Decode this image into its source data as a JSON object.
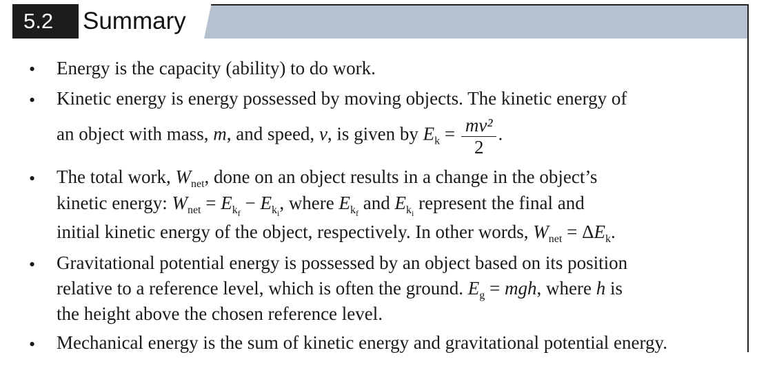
{
  "section": {
    "number": "5.2",
    "title": "Summary"
  },
  "colors": {
    "header_dark": "#1c1c1c",
    "header_bar": "#b6c1cf"
  },
  "bullets": {
    "b1": {
      "line1": "Energy is the capacity (ability) to do work."
    },
    "b2": {
      "line1": "Kinetic energy is energy possessed by moving objects. The kinetic energy of",
      "line2_pre": "an object with mass, ",
      "m": "m",
      "line2_mid": ", and speed, ",
      "v": "v",
      "line2_post": ", is given by ",
      "Ek": "E",
      "k_sub": "k",
      "eq": " = ",
      "frac_num": "mv²",
      "frac_den": "2",
      "end": "."
    },
    "b3": {
      "line1_pre": "The total work, ",
      "W": "W",
      "net": "net",
      "line1_post": ", done on an object results in a change in the object’s",
      "line2_pre": "kinetic energy: ",
      "line2_eq": " = ",
      "E": "E",
      "k": "k",
      "f": "f",
      "i": "i",
      "minus": " − ",
      "where": ", where ",
      "and": " and ",
      "line2_post": " represent the final and",
      "line3_pre": "initial kinetic energy of the object, respectively. In other words, ",
      "line3_eq": " = Δ",
      "line3_end": "."
    },
    "b4": {
      "line1": "Gravitational potential energy is possessed by an object based on its position",
      "line2_pre": "relative to a reference level, which is often the ground. ",
      "Eg": "E",
      "g": "g",
      "line2_eq": " = ",
      "mgh": "mgh",
      "line2_mid": ", where ",
      "h": "h",
      "line2_post": " is",
      "line3": "the height above the chosen reference level."
    },
    "b5": {
      "line1": "Mechanical energy is the sum of kinetic energy and gravitational potential energy."
    },
    "marker": "•"
  }
}
